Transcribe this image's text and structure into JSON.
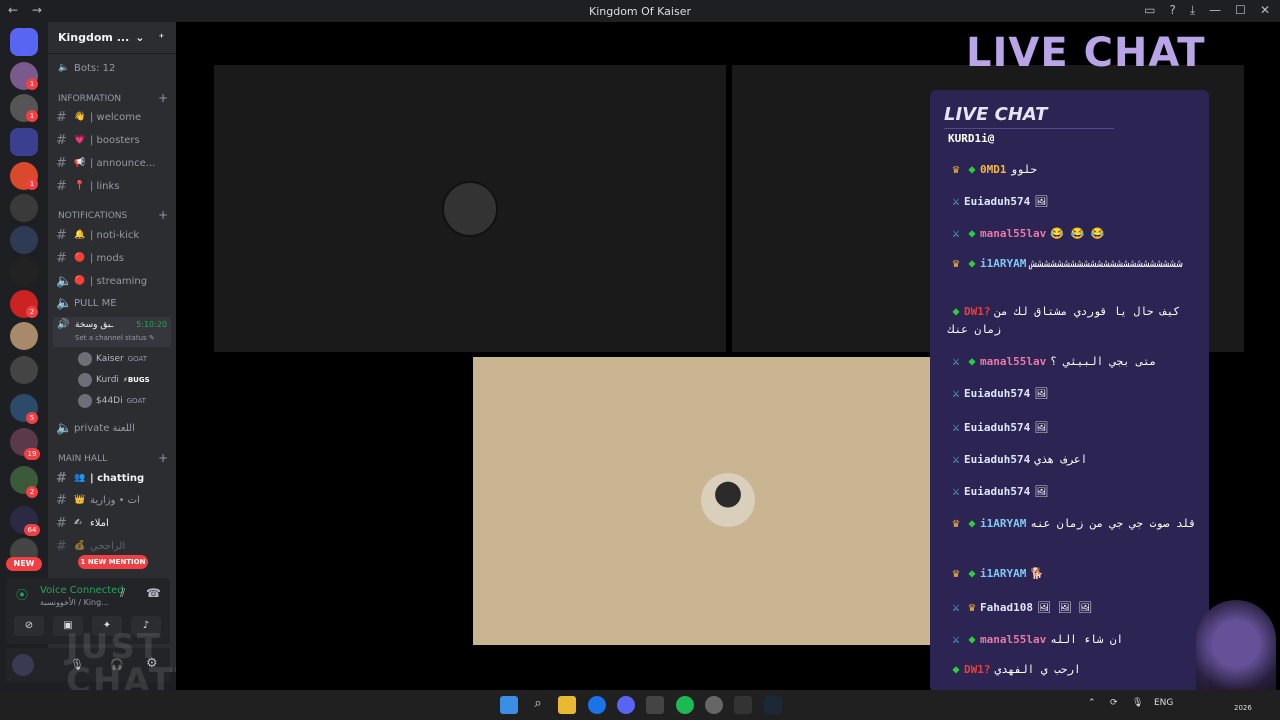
{
  "window": {
    "title": "Kingdom Of Kaiser",
    "nav_back": "←",
    "nav_forward": "→",
    "controls": [
      "▭",
      "?",
      "⤓",
      "—",
      "☐",
      "✕"
    ]
  },
  "servers": {
    "badges": [
      "1",
      "1",
      "1",
      "2",
      "5",
      "19",
      "2",
      "64"
    ],
    "new_label": "NEW"
  },
  "guild": {
    "name": "Kingdom ...",
    "bots_label": "Bots: 12",
    "categories": {
      "information": "INFORMATION",
      "notifications": "NOTIFICATIONS",
      "main_hall": "MAIN HALL"
    },
    "channels": {
      "welcome": "| welcome",
      "boosters": "| boosters",
      "announce": "| announce...",
      "links": "| links",
      "noti_kick": "| noti-kick",
      "mods": "| mods",
      "streaming": "| streaming",
      "pull_me": "PULL ME",
      "active_voice": "ـبق وسخة",
      "active_voice_time": "5:10:20",
      "set_status": "Set a channel status ✎",
      "private": "private اللعنة",
      "chatting": "| chatting",
      "wizaria": "ات • وزارية",
      "emla": "املاء",
      "rajhi": "الراجحي"
    },
    "voice_users": [
      {
        "name": "Kaiser",
        "tag": "GOAT"
      },
      {
        "name": "Kurdi",
        "tag": "⚡BUGS"
      },
      {
        "name": "$44Di",
        "tag": "GOAT"
      }
    ],
    "mention_pill": "1 NEW MENTION"
  },
  "voice_panel": {
    "status": "Voice Connected",
    "sub": "الأخوونسبة / King..."
  },
  "watermark": {
    "line1": "JUST",
    "line2": "CHATTING"
  },
  "live_chat": {
    "overlay_title": "LIVE CHAT",
    "box_title": "LIVE CHAT",
    "messages": [
      {
        "icons": "",
        "name": "KURD1i@",
        "name_color": "#ffffff",
        "text": ""
      },
      {
        "icons": "crown,gem",
        "name": "0MD1",
        "name_color": "#f6b93b",
        "text": "حلوو"
      },
      {
        "icons": "sword",
        "name": "Euiaduh574",
        "name_color": "#dfe6ff",
        "text": "🖼"
      },
      {
        "icons": "sword,gem",
        "name": "manal55lav",
        "name_color": "#e879a8",
        "text": "😂 😂 😂"
      },
      {
        "icons": "crown,gem",
        "name": "i1ARYAM",
        "name_color": "#7ec8f5",
        "text": "ششششششششششششششششششششششش"
      },
      {
        "icons": "gem",
        "name": "DW1?",
        "name_color": "#e83e3e",
        "text": "كيف حال يا قوردي مشتاق لك من زمان عنك"
      },
      {
        "icons": "sword,gem",
        "name": "manal55lav",
        "name_color": "#e879a8",
        "text": "متى بجي البيثي ؟"
      },
      {
        "icons": "sword",
        "name": "Euiaduh574",
        "name_color": "#dfe6ff",
        "text": "🖼"
      },
      {
        "icons": "sword",
        "name": "Euiaduh574",
        "name_color": "#dfe6ff",
        "text": "🖼"
      },
      {
        "icons": "sword",
        "name": "Euiaduh574",
        "name_color": "#dfe6ff",
        "text": "اعرف هذي"
      },
      {
        "icons": "sword",
        "name": "Euiaduh574",
        "name_color": "#dfe6ff",
        "text": "🖼"
      },
      {
        "icons": "crown,gem",
        "name": "i1ARYAM",
        "name_color": "#7ec8f5",
        "text": "قلد صوت جي جي من زمان عنه"
      },
      {
        "icons": "crown,gem",
        "name": "i1ARYAM",
        "name_color": "#7ec8f5",
        "text": "🐕"
      },
      {
        "icons": "sword,crown",
        "name": "Fahad108",
        "name_color": "#dfe6ff",
        "text": "🖼 🖼 🖼"
      },
      {
        "icons": "sword,gem",
        "name": "manal55lav",
        "name_color": "#e879a8",
        "text": "ان شاء الله"
      },
      {
        "icons": "gem",
        "name": "DW1?",
        "name_color": "#e83e3e",
        "text": "ارحب ي الفهدي"
      }
    ]
  },
  "tray": {
    "lang": "ENG",
    "year": "2026"
  }
}
